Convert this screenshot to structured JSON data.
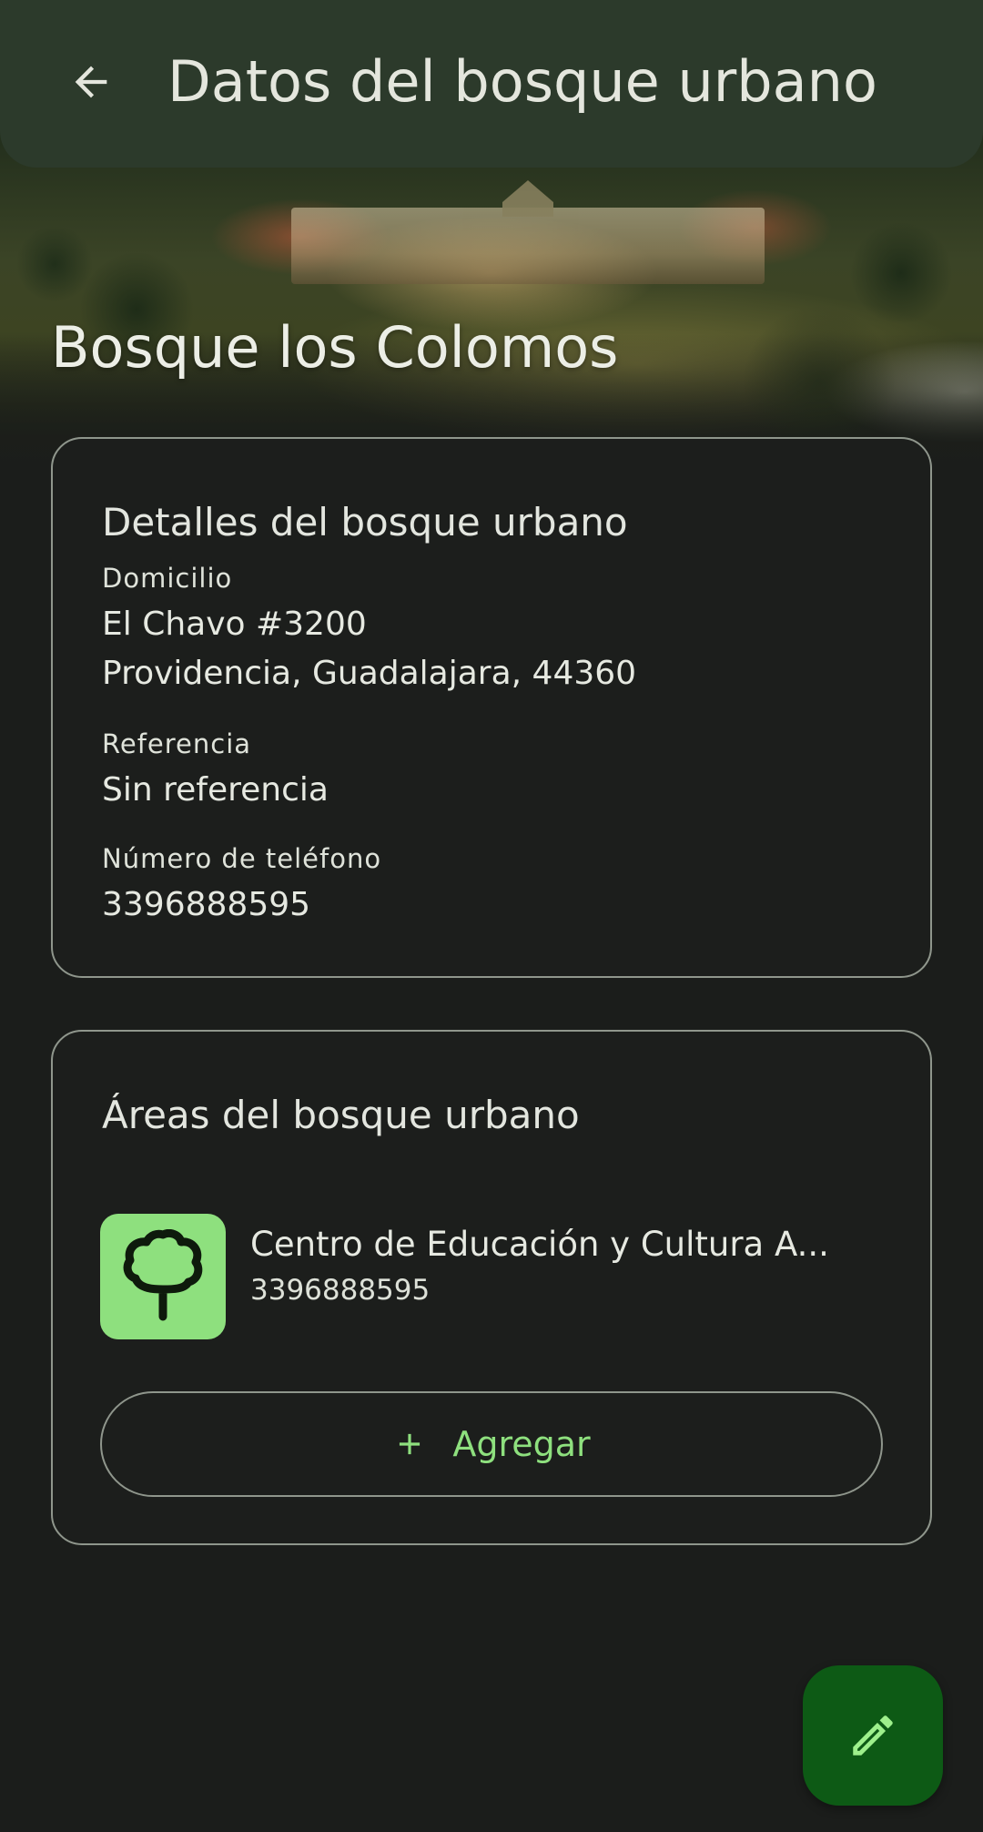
{
  "top_bar": {
    "title": "Datos del bosque urbano",
    "back_icon": "arrow-back-icon"
  },
  "forest": {
    "name": "Bosque los Colomos"
  },
  "details_card": {
    "title": "Detalles del bosque urbano",
    "address_label": "Domicilio",
    "address_line1": "El Chavo #3200",
    "address_line2": "Providencia, Guadalajara, 44360",
    "reference_label": "Referencia",
    "reference_value": "Sin referencia",
    "phone_label": "Número de teléfono",
    "phone_value": "3396888595"
  },
  "areas_card": {
    "title": "Áreas del bosque urbano",
    "items": [
      {
        "name": "Centro de Educación y Cultura A...",
        "phone": "3396888595",
        "icon": "tree-icon"
      }
    ],
    "add_label": "Agregar",
    "add_icon": "plus-icon"
  },
  "fab": {
    "icon": "edit-pencil-icon"
  },
  "colors": {
    "background": "#1b1d1b",
    "top_bar": "#2c3a2b",
    "accent_green": "#8ee07e",
    "fab_green": "#0d5a15",
    "outline": "#8f968c"
  }
}
